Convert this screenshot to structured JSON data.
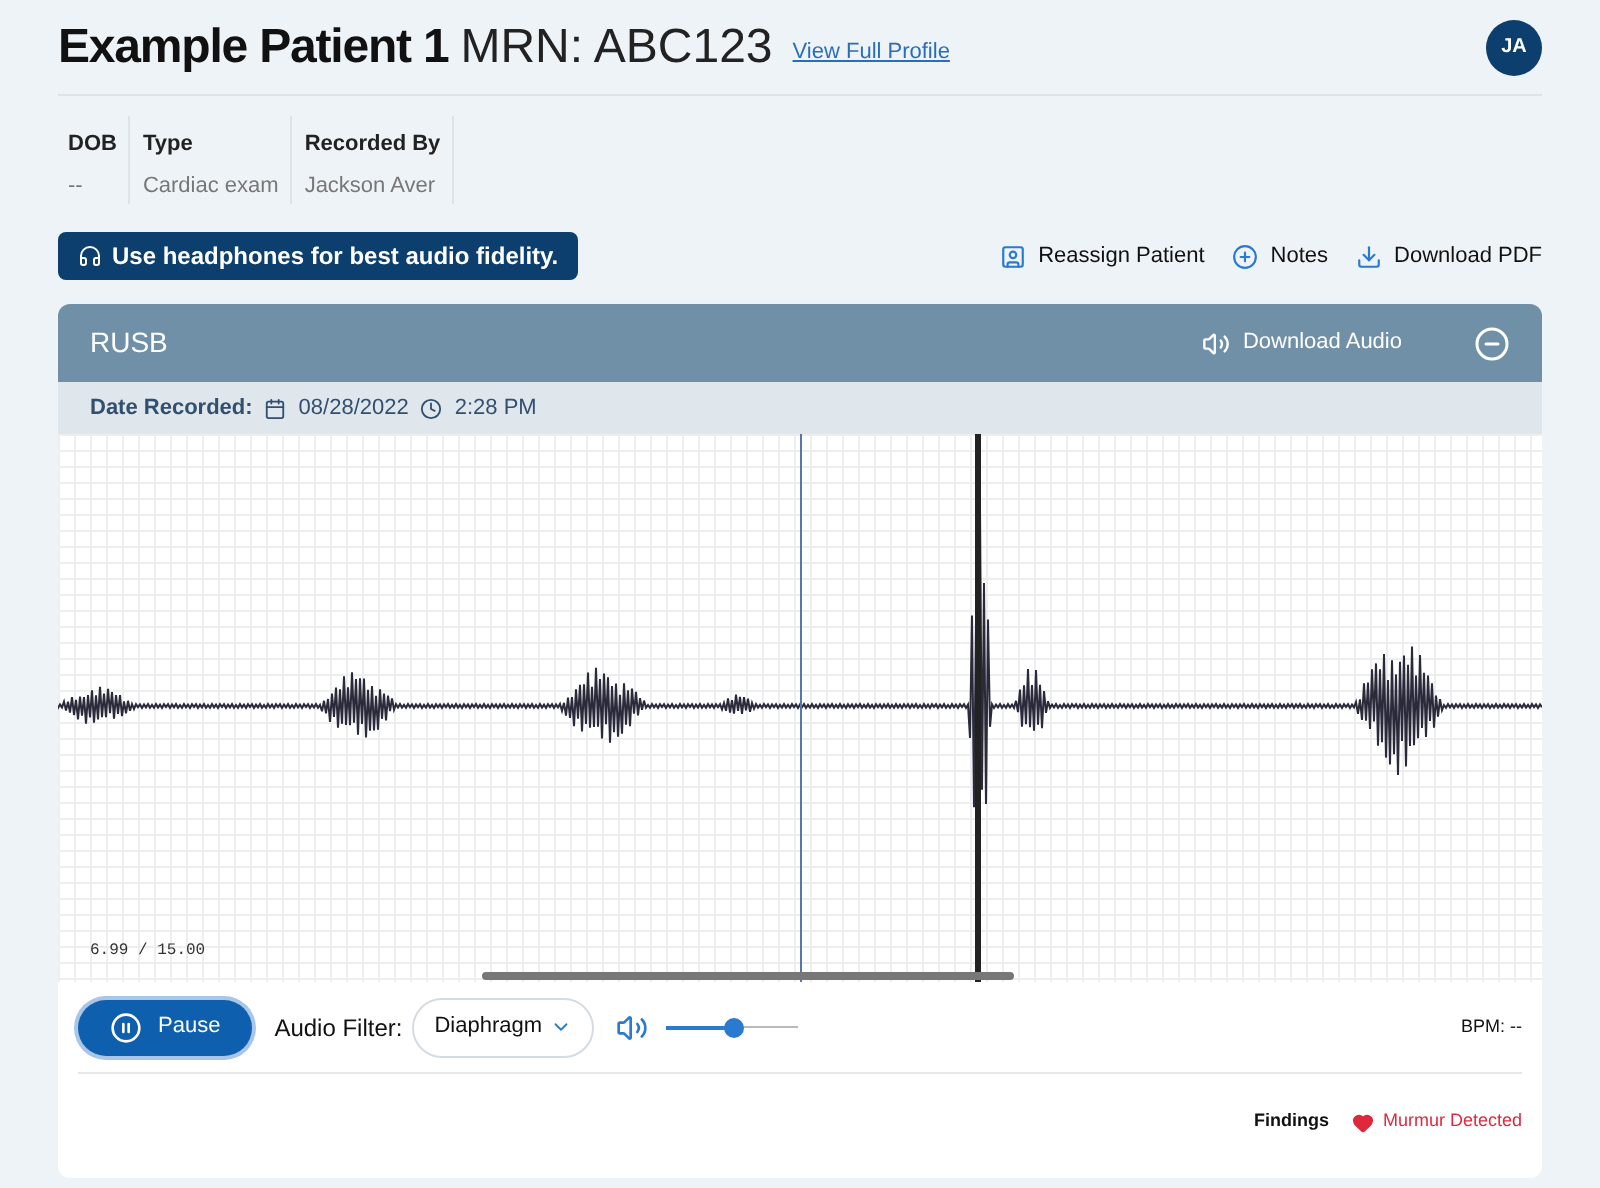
{
  "header": {
    "patient_name": "Example Patient 1",
    "mrn": "MRN: ABC123",
    "profile_link": "View Full Profile",
    "avatar": "JA"
  },
  "info": [
    {
      "label": "DOB",
      "value": "--"
    },
    {
      "label": "Type",
      "value": "Cardiac exam"
    },
    {
      "label": "Recorded By",
      "value": "Jackson Aver"
    }
  ],
  "banner": "Use headphones for best audio fidelity.",
  "actions": [
    {
      "kind": "reassign",
      "label": "Reassign Patient"
    },
    {
      "kind": "notes",
      "label": "Notes"
    },
    {
      "kind": "download",
      "label": "Download PDF"
    }
  ],
  "recording": {
    "title": "RUSB",
    "download_audio": "Download Audio",
    "date_label": "Date Recorded:",
    "date": "08/28/2022",
    "time": "2:28 PM",
    "position": "6.99 / 15.00"
  },
  "controls": {
    "pause": "Pause",
    "filter_label": "Audio Filter:",
    "filter_value": "Diaphragm",
    "volume": {
      "level": 0.52
    },
    "bpm": "BPM: --"
  },
  "findings": {
    "label": "Findings",
    "result": "Murmur Detected"
  }
}
